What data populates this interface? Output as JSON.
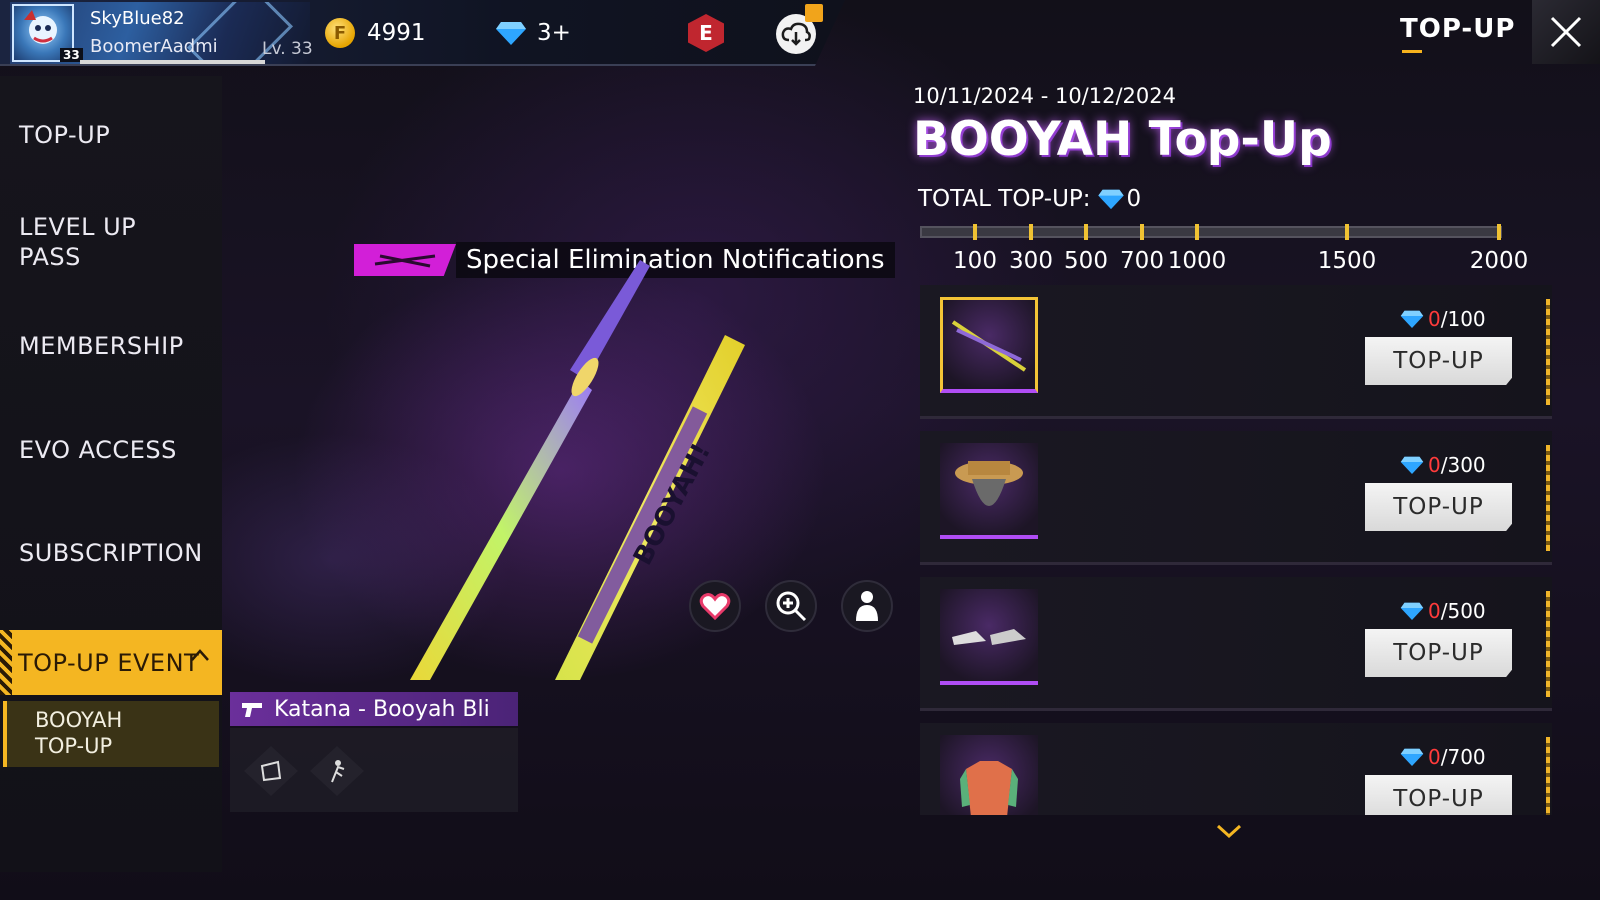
{
  "header": {
    "player_name": "SkyBlue82",
    "player_subtitle": "BoomerAadmi",
    "player_level": "Lv. 33",
    "avatar_level": "33",
    "gold": "4991",
    "diamonds": "3+",
    "elite_badge": "E",
    "page_title": "TOP-UP",
    "coin_symbol": "F"
  },
  "sidebar": {
    "items": [
      {
        "label": "TOP-UP"
      },
      {
        "label": "LEVEL UP\nPASS"
      },
      {
        "label": "MEMBERSHIP"
      },
      {
        "label": "EVO ACCESS"
      },
      {
        "label": "SUBSCRIPTION"
      }
    ],
    "active_label": "TOP-UP EVENT",
    "sub_item_label": "BOOYAH\nTOP-UP"
  },
  "showcase": {
    "notification_text": "Special Elimination Notifications",
    "item_name": "Katana - Booyah Bli",
    "sword_text": "BOOYAH!"
  },
  "event": {
    "date_range": "10/11/2024 - 10/12/2024",
    "title": "BOOYAH Top-Up",
    "total_label": "TOTAL TOP-UP:",
    "total_value": "0",
    "milestones": [
      "100",
      "300",
      "500",
      "700",
      "1000",
      "1500",
      "2000"
    ],
    "rewards": [
      {
        "current": "0",
        "target": "/100",
        "button": "TOP-UP",
        "icon": "katana-icon"
      },
      {
        "current": "0",
        "target": "/300",
        "button": "TOP-UP",
        "icon": "hat-icon"
      },
      {
        "current": "0",
        "target": "/500",
        "button": "TOP-UP",
        "icon": "shoes-icon"
      },
      {
        "current": "0",
        "target": "/700",
        "button": "TOP-UP",
        "icon": "outfit-icon"
      }
    ]
  },
  "colors": {
    "accent_gold": "#f4b622",
    "accent_purple": "#b04df5",
    "notif_magenta": "#d21fd8",
    "progress_red": "#ff3b3b"
  }
}
